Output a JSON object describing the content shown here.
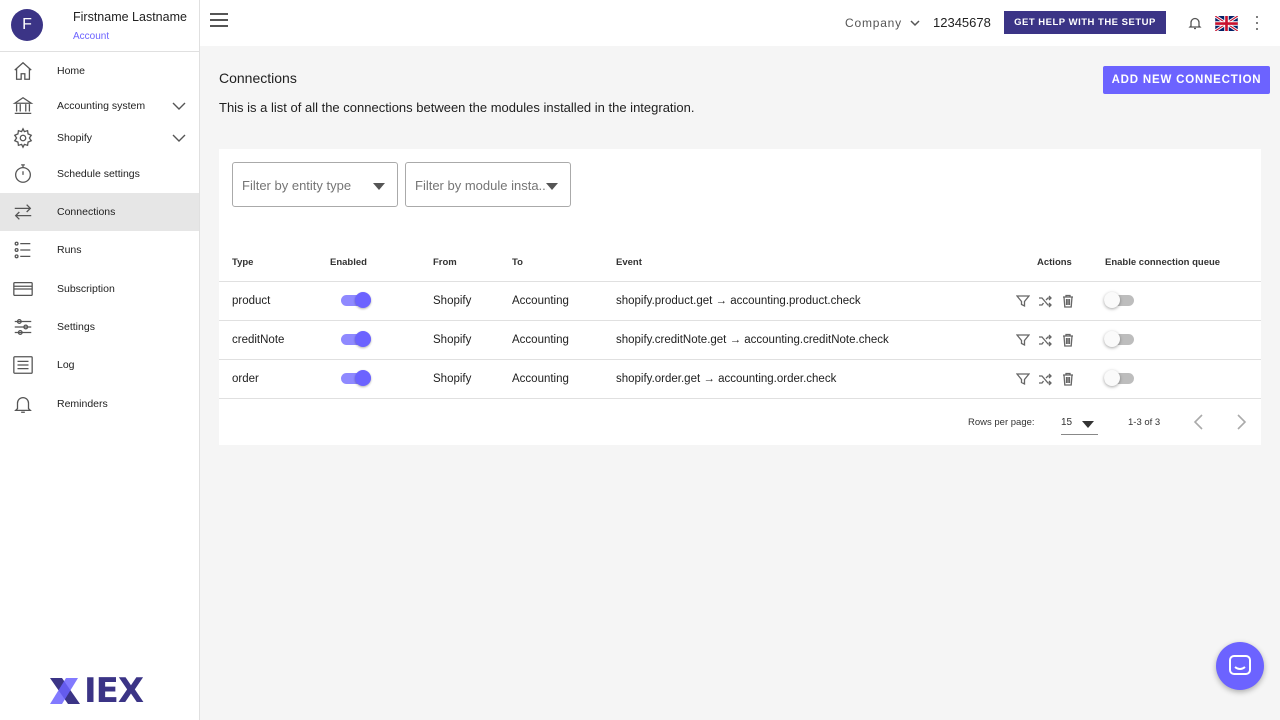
{
  "user": {
    "initial": "F",
    "name": "Firstname Lastname",
    "subtitle": "Account"
  },
  "sidebar": {
    "items": [
      {
        "label": "Home",
        "icon": "home-icon"
      },
      {
        "label": "Accounting system",
        "icon": "bank-icon",
        "expandable": true
      },
      {
        "label": "Shopify",
        "icon": "gear-icon",
        "expandable": true
      },
      {
        "label": "Schedule settings",
        "icon": "stopwatch-icon"
      },
      {
        "label": "Connections",
        "icon": "arrows-icon",
        "active": true
      },
      {
        "label": "Runs",
        "icon": "list-tree-icon"
      },
      {
        "label": "Subscription",
        "icon": "card-icon"
      },
      {
        "label": "Settings",
        "icon": "sliders-icon"
      },
      {
        "label": "Log",
        "icon": "log-icon"
      },
      {
        "label": "Reminders",
        "icon": "bell-icon"
      }
    ],
    "logo_text": "IEX"
  },
  "header": {
    "company_label": "Company",
    "company_id": "12345678",
    "help_label": "GET HELP WITH THE SETUP"
  },
  "page": {
    "title": "Connections",
    "description": "This is a list of all the connections between the modules installed in the integration.",
    "add_label": "ADD NEW CONNECTION"
  },
  "filters": {
    "entity_placeholder": "Filter by entity type",
    "module_placeholder": "Filter by module insta..."
  },
  "table": {
    "headers": {
      "type": "Type",
      "enabled": "Enabled",
      "from": "From",
      "to": "To",
      "event": "Event",
      "actions": "Actions",
      "queue": "Enable connection queue"
    },
    "rows": [
      {
        "type": "product",
        "enabled": true,
        "from": "Shopify",
        "to": "Accounting",
        "event": "shopify.product.get → accounting.product.check",
        "queue": false
      },
      {
        "type": "creditNote",
        "enabled": true,
        "from": "Shopify",
        "to": "Accounting",
        "event": "shopify.creditNote.get → accounting.creditNote.check",
        "queue": false
      },
      {
        "type": "order",
        "enabled": true,
        "from": "Shopify",
        "to": "Accounting",
        "event": "shopify.order.get → accounting.order.check",
        "queue": false
      }
    ]
  },
  "pagination": {
    "rows_per_page_label": "Rows per page:",
    "rows_per_page": "15",
    "range": "1-3 of 3"
  },
  "colors": {
    "primary": "#3b3486",
    "accent": "#6c63ff"
  }
}
